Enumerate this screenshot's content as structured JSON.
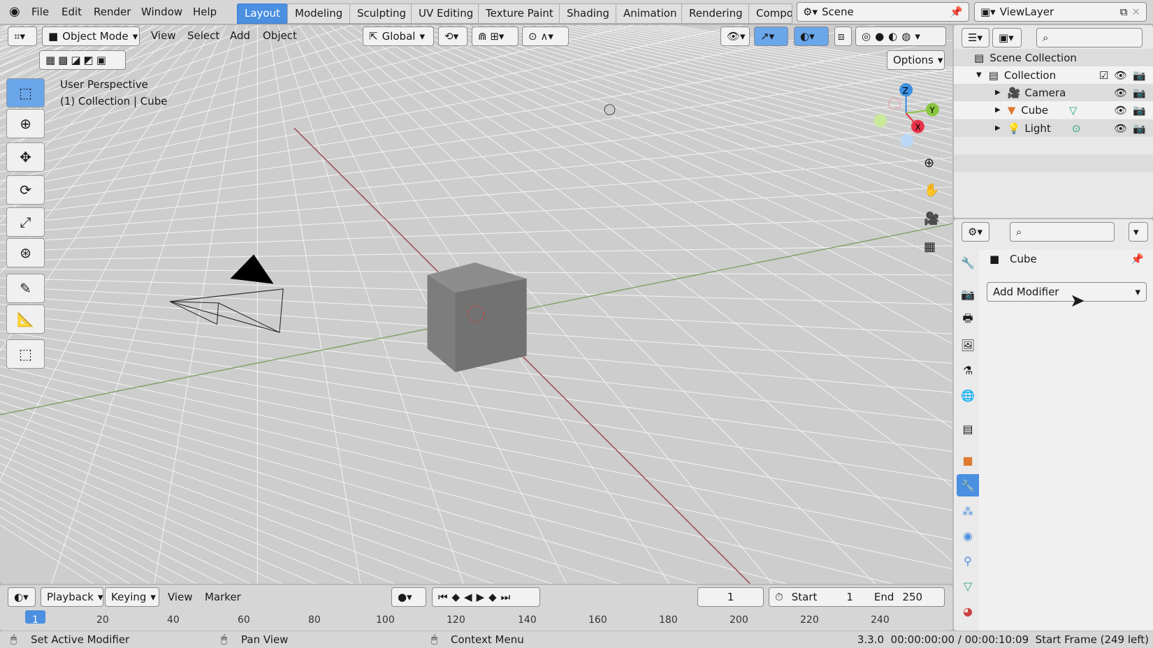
{
  "topbar": {
    "menus": [
      "File",
      "Edit",
      "Render",
      "Window",
      "Help"
    ],
    "workspaces": [
      {
        "label": "Layout",
        "active": true
      },
      {
        "label": "Modeling"
      },
      {
        "label": "Sculpting"
      },
      {
        "label": "UV Editing"
      },
      {
        "label": "Texture Paint"
      },
      {
        "label": "Shading"
      },
      {
        "label": "Animation"
      },
      {
        "label": "Rendering"
      },
      {
        "label": "Compo"
      }
    ],
    "scene": "Scene",
    "view_layer": "ViewLayer"
  },
  "viewport": {
    "mode": "Object Mode",
    "menus": [
      "View",
      "Select",
      "Add",
      "Object"
    ],
    "orientation": "Global",
    "options": "Options",
    "overlay_title": "User Perspective",
    "overlay_sub": "(1) Collection | Cube",
    "gizmo": {
      "x": "X",
      "y": "Y",
      "z": "Z",
      "x_color": "#e8334a",
      "y_color": "#8bc63f",
      "z_color": "#3d8fe0"
    }
  },
  "outliner": {
    "root": "Scene Collection",
    "collection": "Collection",
    "items": [
      "Camera",
      "Cube",
      "Light"
    ]
  },
  "properties": {
    "object": "Cube",
    "add_modifier": "Add Modifier",
    "active_tab_color": "#4a8fe0"
  },
  "timeline": {
    "menus": [
      "Playback",
      "Keying",
      "View",
      "Marker"
    ],
    "current_frame": "1",
    "start_label": "Start",
    "start": "1",
    "end_label": "End",
    "end": "250",
    "ticks": [
      "1",
      "20",
      "40",
      "60",
      "80",
      "100",
      "120",
      "140",
      "160",
      "180",
      "200",
      "220",
      "240"
    ]
  },
  "status": {
    "hints": [
      "Set Active Modifier",
      "Pan View",
      "Context Menu"
    ],
    "info": "3.3.0  00:00:00:00 / 00:00:10:09  Start Frame (249 left)"
  }
}
